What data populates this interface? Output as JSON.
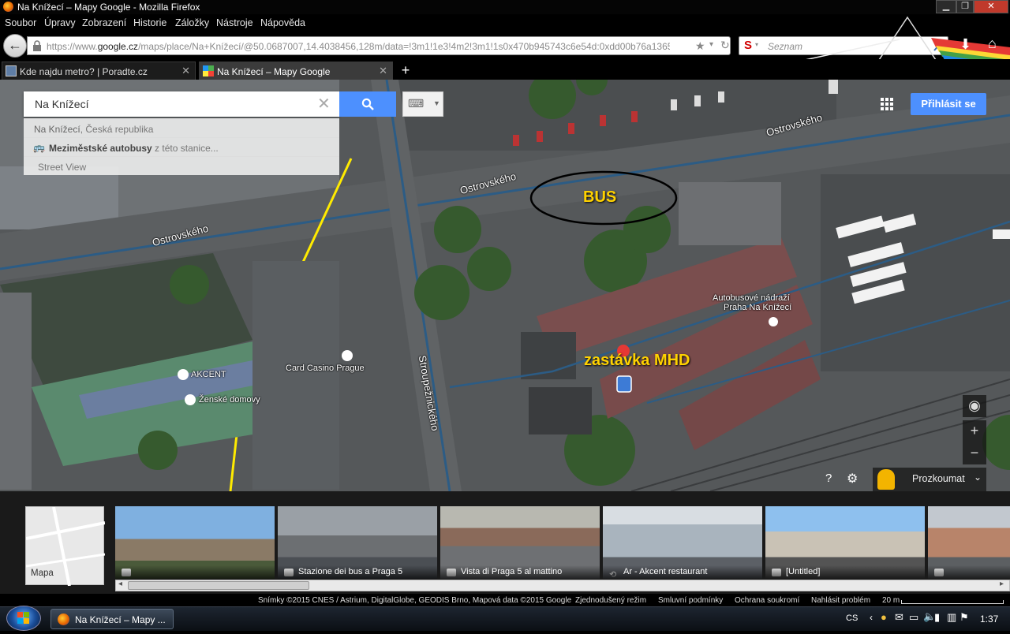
{
  "window": {
    "title": "Na Knížecí – Mapy Google - Mozilla Firefox"
  },
  "menu": [
    "Soubor",
    "Úpravy",
    "Zobrazení",
    "Historie",
    "Záložky",
    "Nástroje",
    "Nápověda"
  ],
  "nav": {
    "url_prefix": "https://www.",
    "url_host": "google.cz",
    "url_rest": "/maps/place/Na+Knížecí/@50.0687007,14.4038456,128m/data=!3m1!1e3!4m2!3m1!1s0x470b945743c6e54d:0xdd00b76a1365e7a2?hl=",
    "search_placeholder": "Seznam"
  },
  "tabs": [
    {
      "label": "Kde najdu metro? | Poradte.cz",
      "active": false
    },
    {
      "label": "Na Knížecí – Mapy Google",
      "active": true
    }
  ],
  "maps": {
    "search_value": "Na Knížecí",
    "suggestions": [
      {
        "bold": "Na Knížecí",
        "rest": ", Česká republika"
      },
      {
        "bold": "Meziměstské autobusy",
        "rest": " z této stanice..."
      },
      {
        "bold": "",
        "rest": "Street View"
      }
    ],
    "signin_label": "Přihlásit se",
    "explore_label": "Prozkoumat",
    "labels": {
      "street_top_right": "Ostrovského",
      "street_mid": "Ostrovského",
      "street_left": "Ostrovského",
      "street_vertical": "Stroupežnického",
      "bus_station_line1": "Autobusové nádraží",
      "bus_station_line2": "Praha Na Knížecí",
      "casino": "Card Casino Prague",
      "hotel": "AKCENT",
      "dorm": "Ženské domovy"
    },
    "annotations": {
      "bus": "BUS",
      "stop": "zastávka MHD"
    }
  },
  "filmstrip": {
    "map_label": "Mapa",
    "photos": [
      {
        "caption": ""
      },
      {
        "caption": "Stazione dei bus a Praga 5"
      },
      {
        "caption": "Vista di Praga 5 al mattino"
      },
      {
        "caption": "Ar - Akcent restaurant"
      },
      {
        "caption": "[Untitled]"
      },
      {
        "caption": ""
      }
    ]
  },
  "footer": {
    "attribution": "Snímky ©2015 CNES / Astrium, DigitalGlobe, GEODIS Brno, Mapová data ©2015 Google",
    "simple_mode": "Zjednodušený režim",
    "terms": "Smluvní podmínky",
    "privacy": "Ochrana soukromí",
    "report": "Nahlásit problém",
    "scale": "20 m"
  },
  "taskbar": {
    "firefox_label": "Na Knížecí – Mapy ...",
    "lang": "CS",
    "clock": "1:37"
  },
  "colors": {
    "accent": "#4d90fe",
    "annotation": "#ffd200"
  }
}
